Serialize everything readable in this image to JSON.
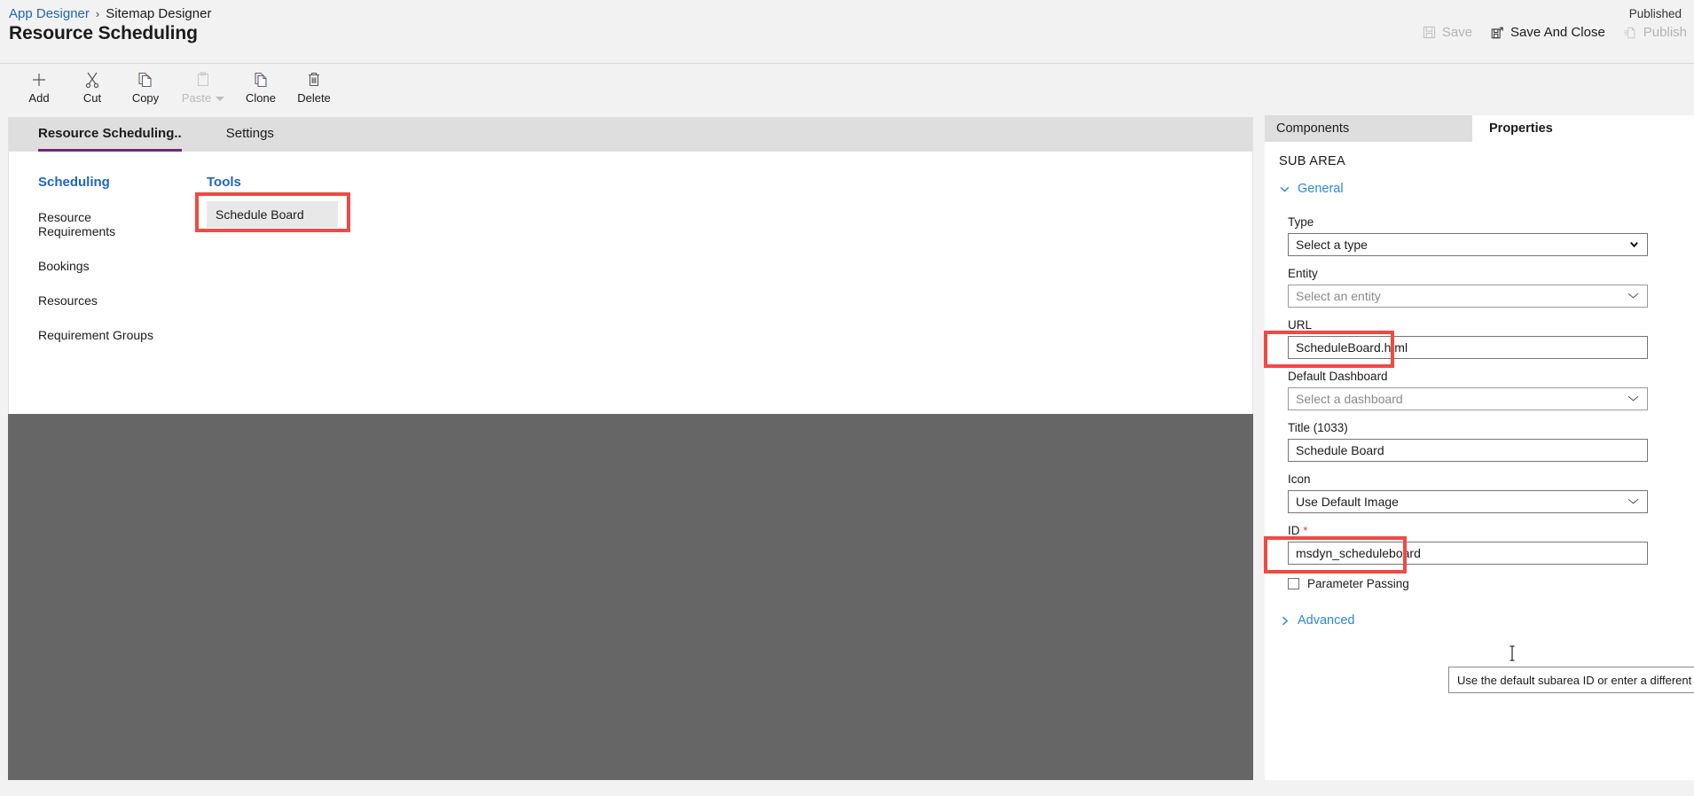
{
  "header": {
    "breadcrumb": [
      {
        "label": "App Designer",
        "active": true
      },
      {
        "label": "Sitemap Designer",
        "active": false
      }
    ],
    "separator": "›",
    "title": "Resource Scheduling",
    "published_status": "Published",
    "actions": [
      {
        "label": "Save",
        "icon": "save-icon",
        "disabled": true
      },
      {
        "label": "Save And Close",
        "icon": "save-and-close-icon",
        "disabled": false
      },
      {
        "label": "Publish",
        "icon": "publish-icon",
        "disabled": true
      }
    ]
  },
  "toolbar": {
    "items": [
      {
        "label": "Add",
        "icon": "plus-icon",
        "disabled": false,
        "caret": false
      },
      {
        "label": "Cut",
        "icon": "scissors-icon",
        "disabled": false,
        "caret": false
      },
      {
        "label": "Copy",
        "icon": "copy-icon",
        "disabled": false,
        "caret": false
      },
      {
        "label": "Paste",
        "icon": "clipboard-icon",
        "disabled": true,
        "caret": true
      },
      {
        "label": "Clone",
        "icon": "clone-icon",
        "disabled": false,
        "caret": false
      },
      {
        "label": "Delete",
        "icon": "trash-icon",
        "disabled": false,
        "caret": false
      }
    ]
  },
  "canvas": {
    "tabs": [
      {
        "label": "Resource Scheduling..",
        "active": true
      },
      {
        "label": "Settings",
        "active": false
      }
    ],
    "group_column": {
      "header": "Scheduling",
      "items": [
        "Resource Requirements",
        "Bookings",
        "Resources",
        "Requirement Groups"
      ]
    },
    "tools_column": {
      "header": "Tools",
      "tile_label": "Schedule Board"
    }
  },
  "right_panel": {
    "tabs": [
      {
        "label": "Components",
        "active": false
      },
      {
        "label": "Properties",
        "active": true
      }
    ],
    "section_title": "SUB AREA",
    "general": {
      "label": "General",
      "expanded": true,
      "fields": [
        {
          "name": "type",
          "label": "Type",
          "value": "Select a type",
          "kind": "select",
          "placeholder": false,
          "required": false,
          "highlighted": false
        },
        {
          "name": "entity",
          "label": "Entity",
          "value": "Select an entity",
          "kind": "dropdown",
          "placeholder": true,
          "required": false,
          "highlighted": false
        },
        {
          "name": "url",
          "label": "URL",
          "value": "ScheduleBoard.html",
          "kind": "text",
          "placeholder": false,
          "required": false,
          "highlighted": true
        },
        {
          "name": "dashboard",
          "label": "Default Dashboard",
          "value": "Select a dashboard",
          "kind": "dropdown",
          "placeholder": true,
          "required": false,
          "highlighted": false
        },
        {
          "name": "title",
          "label": "Title (1033)",
          "value": "Schedule Board",
          "kind": "text",
          "placeholder": false,
          "required": false,
          "highlighted": false
        },
        {
          "name": "icon",
          "label": "Icon",
          "value": "Use Default Image",
          "kind": "dropdown",
          "placeholder": false,
          "required": false,
          "highlighted": false
        },
        {
          "name": "id",
          "label": "ID",
          "value": "msdyn_scheduleboard",
          "kind": "text",
          "placeholder": false,
          "required": true,
          "highlighted": true
        }
      ],
      "required_marker": "*",
      "checkbox": {
        "label": "Parameter Passing",
        "checked": false
      }
    },
    "advanced": {
      "label": "Advanced",
      "expanded": false
    }
  },
  "tooltip": {
    "text": "Use the default subarea ID or enter a different one."
  },
  "colors": {
    "accent_purple": "#742774",
    "link_blue": "#2b88d8",
    "breadcrumb_blue": "#2266bb",
    "highlight_red": "#f04a43",
    "canvas_gray": "#666666",
    "chrome_gray": "#f2f2f2",
    "tab_inactive": "#dedede"
  }
}
